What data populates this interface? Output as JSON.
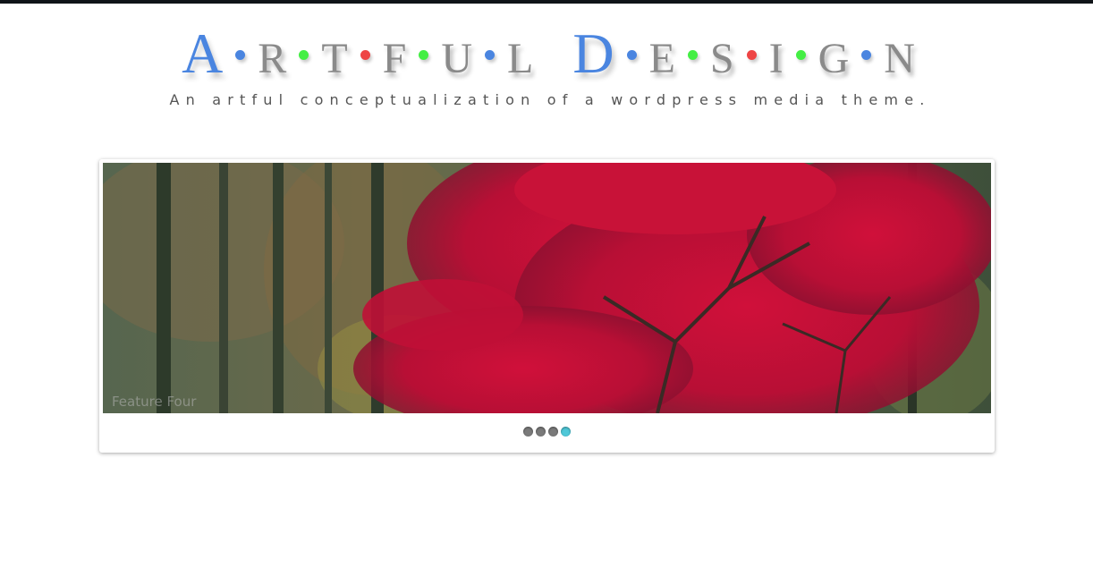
{
  "header": {
    "logo_words": [
      [
        "A",
        "R",
        "T",
        "F",
        "U",
        "L"
      ],
      [
        "D",
        "E",
        "S",
        "I",
        "G",
        "N"
      ]
    ],
    "logo_dot_colors": [
      [
        "#4a85e0",
        "#44ee44",
        "#ee4444",
        "#44ee44",
        "#4a85e0"
      ],
      [
        "#4a85e0",
        "#44ee44",
        "#ee4444",
        "#44ee44",
        "#4a85e0"
      ]
    ],
    "tagline": "An artful conceptualization of a wordpress media theme."
  },
  "slider": {
    "caption": "Feature Four",
    "slide_count": 4,
    "active_index": 3,
    "active_color": "#4fc8d8",
    "inactive_color": "#7a7a7a"
  }
}
